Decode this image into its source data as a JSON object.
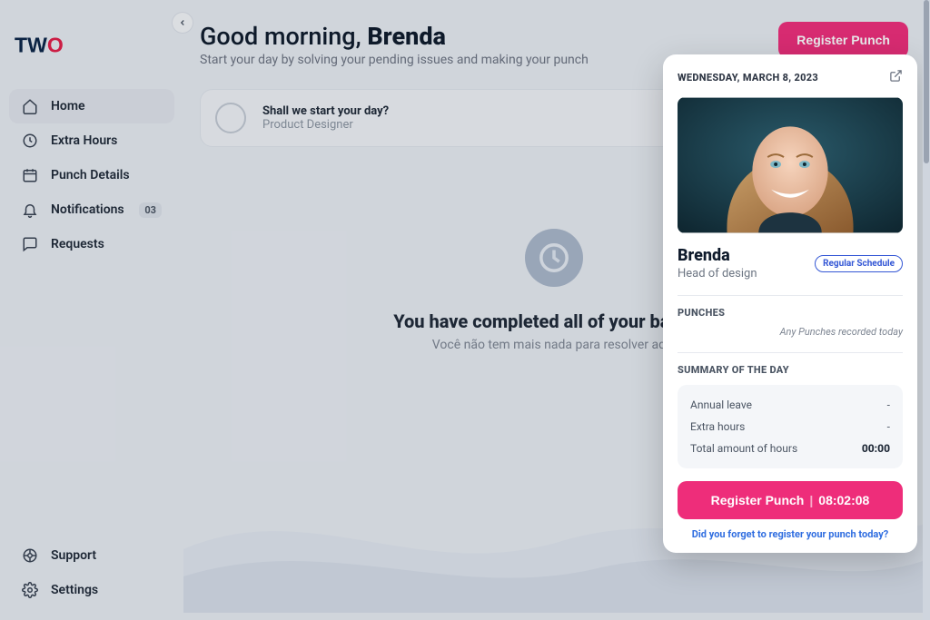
{
  "logo": "TWO",
  "sidebar": {
    "items": [
      {
        "label": "Home",
        "icon": "home-icon"
      },
      {
        "label": "Extra Hours",
        "icon": "clock-icon"
      },
      {
        "label": "Punch Details",
        "icon": "calendar-icon"
      },
      {
        "label": "Notifications",
        "icon": "bell-icon",
        "badge": "03"
      },
      {
        "label": "Requests",
        "icon": "chat-icon"
      }
    ],
    "bottom": [
      {
        "label": "Support",
        "icon": "support-icon"
      },
      {
        "label": "Settings",
        "icon": "gear-icon"
      }
    ]
  },
  "header": {
    "greeting_prefix": "Good morning, ",
    "greeting_name": "Brenda",
    "subtitle": "Start your day by solving your pending issues and making your punch",
    "register_btn": "Register Punch"
  },
  "task": {
    "title": "Shall we start your day?",
    "role": "Product Designer",
    "menu": ":"
  },
  "empty": {
    "title": "You have completed all of your backlog",
    "subtitle": "Você não tem mais nada para resolver aqui"
  },
  "panel": {
    "date": "WEDNESDAY, MARCH 8, 2023",
    "name": "Brenda",
    "role": "Head of design",
    "schedule_badge": "Regular Schedule",
    "punches_label": "PUNCHES",
    "punches_empty": "Any Punches recorded today",
    "summary_label": "SUMMARY OF THE DAY",
    "summary": [
      {
        "label": "Annual leave",
        "value": "-"
      },
      {
        "label": "Extra hours",
        "value": "-"
      },
      {
        "label": "Total amount of hours",
        "value": "00:00",
        "total": true
      }
    ],
    "register_btn": "Register Punch",
    "register_time": "08:02:08",
    "forgot_link": "Did you forget to register your punch today?"
  }
}
